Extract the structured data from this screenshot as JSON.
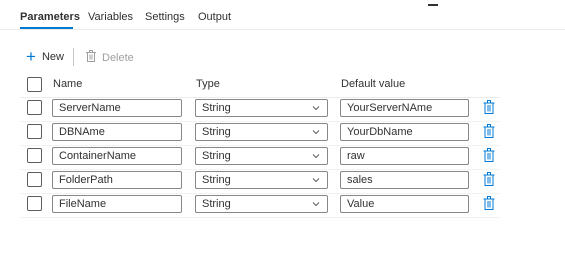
{
  "tabs": [
    {
      "label": "Parameters",
      "active": true
    },
    {
      "label": "Variables",
      "active": false
    },
    {
      "label": "Settings",
      "active": false
    },
    {
      "label": "Output",
      "active": false
    }
  ],
  "toolbar": {
    "new_label": "New",
    "delete_label": "Delete",
    "new_icon": "plus-icon",
    "delete_icon": "trash-icon"
  },
  "columns": {
    "name": "Name",
    "type": "Type",
    "default": "Default value"
  },
  "rows": [
    {
      "name": "ServerName",
      "type": "String",
      "default": "YourServerNAme"
    },
    {
      "name": "DBNAme",
      "type": "String",
      "default": "YourDbName"
    },
    {
      "name": "ContainerName",
      "type": "String",
      "default": "raw"
    },
    {
      "name": "FolderPath",
      "type": "String",
      "default": "sales"
    },
    {
      "name": "FileName",
      "type": "String",
      "default": "Value"
    }
  ],
  "colors": {
    "accent": "#0078d4",
    "text": "#323130",
    "disabled": "#a19f9d",
    "border": "#8a8886"
  }
}
